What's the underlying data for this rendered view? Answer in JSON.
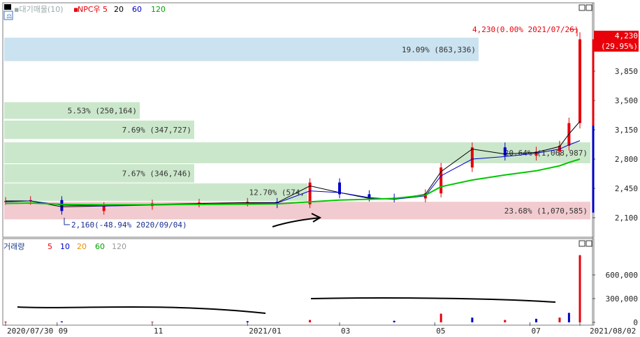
{
  "header": {
    "ma_label": "▪대기매물(10)",
    "ticker_prefix": "▪",
    "ticker": "NPC우",
    "ma5": "5",
    "ma20": "20",
    "ma60": "60",
    "ma120": "120"
  },
  "volume_header": {
    "title": "거래량",
    "ma5": "5",
    "ma10": "10",
    "ma20": "20",
    "ma60": "60",
    "ma120": "120"
  },
  "colors": {
    "up": "#e8000b",
    "down": "#0000c8",
    "ma5": "#000000",
    "ma20": "#0000c8",
    "ma60": "#00c800",
    "ma120": "#7f7f7f",
    "zone_green": "#c8e6c8",
    "zone_blue": "#c8e0ef",
    "zone_red": "#f0c8cc",
    "price_tag_bg": "#e8000b"
  },
  "price_annotations": {
    "high_note": "4,230(0.00% 2021/07/26)",
    "low_note": "2,160(-48.94% 2020/09/04)",
    "current_price": "4,230",
    "current_change": "(29.95%)"
  },
  "chart_data": [
    {
      "type": "line",
      "name_hint": "price",
      "ylim": [
        1950,
        4450
      ],
      "y_ticks": [
        "3,850",
        "3,500",
        "3,150",
        "2,800",
        "2,450",
        "2,100"
      ],
      "y_tick_values": [
        3850,
        3500,
        3150,
        2800,
        2450,
        2100
      ],
      "x_tick_labels": [
        "2020/07/30",
        "09",
        "11",
        "2021/01",
        "03",
        "05",
        "07",
        "2021/08/02"
      ],
      "x": [
        "2020-07-30",
        "2020-08-15",
        "2020-09-04",
        "2020-10-01",
        "2020-11-01",
        "2020-12-01",
        "2021-01-01",
        "2021-01-20",
        "2021-02-10",
        "2021-03-01",
        "2021-03-20",
        "2021-04-05",
        "2021-04-25",
        "2021-05-05",
        "2021-05-25",
        "2021-06-15",
        "2021-07-05",
        "2021-07-20",
        "2021-07-26",
        "2021-08-02"
      ],
      "series": [
        {
          "name": "",
          "values": [
            2300,
            2310,
            2180,
            2240,
            2270,
            2280,
            2290,
            2260,
            2520,
            2380,
            2340,
            2330,
            2390,
            2700,
            2940,
            2840,
            2890,
            2960,
            3230,
            4230
          ]
        },
        {
          "name": "5",
          "values": [
            2300,
            2300,
            2230,
            2240,
            2260,
            2270,
            2280,
            2280,
            2480,
            2400,
            2330,
            2320,
            2380,
            2650,
            2920,
            2860,
            2880,
            2950,
            3100,
            3250
          ]
        },
        {
          "name": "20",
          "values": [
            2290,
            2300,
            2250,
            2240,
            2250,
            2260,
            2270,
            2275,
            2420,
            2400,
            2340,
            2320,
            2360,
            2600,
            2800,
            2830,
            2870,
            2920,
            2970,
            3020
          ]
        },
        {
          "name": "60",
          "values": [
            2270,
            2275,
            2260,
            2255,
            2255,
            2258,
            2262,
            2265,
            2290,
            2310,
            2320,
            2330,
            2370,
            2470,
            2550,
            2610,
            2660,
            2720,
            2760,
            2800
          ]
        }
      ],
      "zones": [
        {
          "label": "19.09% (863,336)",
          "price_low": 3970,
          "price_high": 4250,
          "color": "blue"
        },
        {
          "label": "5.53% (250,164)",
          "price_low": 3280,
          "price_high": 3480,
          "color": "green"
        },
        {
          "label": "7.69% (347,727)",
          "price_low": 3040,
          "price_high": 3260,
          "color": "green"
        },
        {
          "label": "20.64% (1,068,987)",
          "price_low": 2750,
          "price_high": 3000,
          "color": "green"
        },
        {
          "label": "7.67% (346,746)",
          "price_low": 2520,
          "price_high": 2740,
          "color": "green"
        },
        {
          "label": "12.70% (574,",
          "price_low": 2300,
          "price_high": 2510,
          "color": "green"
        },
        {
          "label": "23.68% (1,070,585)",
          "price_low": 2080,
          "price_high": 2290,
          "color": "red"
        }
      ]
    },
    {
      "type": "bar",
      "name_hint": "volume",
      "ylim": [
        0,
        900000
      ],
      "y_ticks": [
        "600,000",
        "300,000",
        "0"
      ],
      "y_tick_values": [
        600000,
        300000,
        0
      ],
      "x": [
        "2020-07-30",
        "2020-09-04",
        "2020-11-01",
        "2021-01-01",
        "2021-02-10",
        "2021-04-05",
        "2021-05-05",
        "2021-05-25",
        "2021-06-15",
        "2021-07-05",
        "2021-07-20",
        "2021-07-26",
        "2021-08-02"
      ],
      "values": [
        10000,
        12000,
        8000,
        15000,
        30000,
        20000,
        110000,
        60000,
        30000,
        45000,
        60000,
        120000,
        850000
      ]
    }
  ]
}
